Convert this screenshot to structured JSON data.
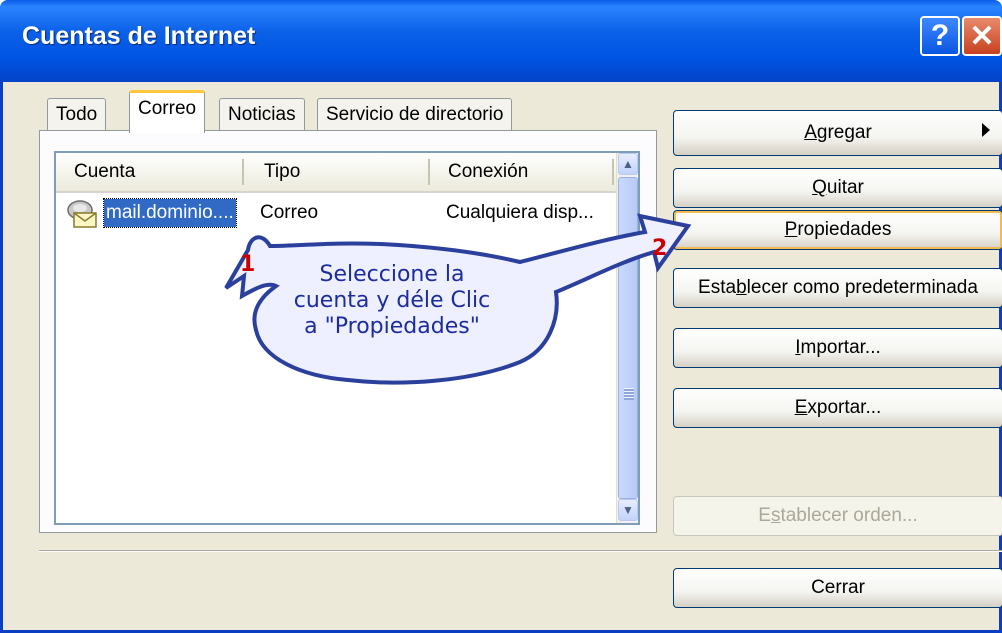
{
  "window": {
    "title": "Cuentas de Internet",
    "help_label": "?",
    "close_label": "✕"
  },
  "tabs": [
    {
      "label": "Todo",
      "active": false
    },
    {
      "label": "Correo",
      "active": true
    },
    {
      "label": "Noticias",
      "active": false
    },
    {
      "label": "Servicio de directorio",
      "active": false
    }
  ],
  "list": {
    "columns": [
      "Cuenta",
      "Tipo",
      "Conexión"
    ],
    "rows": [
      {
        "cuenta": "mail.dominio....",
        "tipo": "Correo",
        "conexion": "Cualquiera disp...",
        "icon": "mail-account-icon",
        "selected": true
      }
    ]
  },
  "buttons": {
    "agregar": {
      "pre": "",
      "u": "A",
      "post": "gregar"
    },
    "quitar": {
      "pre": "",
      "u": "Q",
      "post": "uitar"
    },
    "propiedades": {
      "pre": "",
      "u": "P",
      "post": "ropiedades"
    },
    "predeterminada": {
      "pre": "Esta",
      "u": "b",
      "post": "lecer como predeterminada"
    },
    "importar": {
      "pre": "",
      "u": "I",
      "post": "mportar..."
    },
    "exportar": {
      "pre": "",
      "u": "E",
      "post": "xportar..."
    },
    "orden": {
      "pre": "E",
      "u": "s",
      "post": "tablecer orden..."
    },
    "cerrar": {
      "label": "Cerrar"
    }
  },
  "callout": {
    "lines": [
      "Seleccione la",
      "cuenta y déle Clic",
      "a \"Propiedades\""
    ],
    "step1": "1",
    "step2": "2"
  },
  "colors": {
    "titlebar": "#0a5ce8",
    "selection": "#316ac5",
    "callout_text": "#1c2c9c",
    "step_number": "#cc0000"
  }
}
